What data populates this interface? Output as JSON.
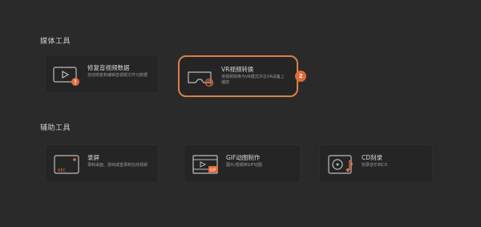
{
  "sections": {
    "media": {
      "title": "媒体工具",
      "cards": [
        {
          "name": "修复音视频数据",
          "desc": "自动修复和编辑音视频文件元数据",
          "icon": "video-repair-icon"
        },
        {
          "name": "VR视频转换",
          "desc": "将视频转换为VR模式并在VR设备上播放",
          "icon": "vr-headset-icon"
        }
      ]
    },
    "aux": {
      "title": "辅助工具",
      "cards": [
        {
          "name": "录屏",
          "desc": "录制桌面、游戏或直录制在线视频",
          "icon": "screen-record-icon"
        },
        {
          "name": "GIF动图制作",
          "desc": "图片/视频转GIF动图",
          "icon": "gif-maker-icon"
        },
        {
          "name": "CD刻录",
          "desc": "刻录音乐到CD",
          "icon": "cd-burn-icon"
        }
      ]
    }
  },
  "badge": "2",
  "colors": {
    "accent": "#d98048",
    "badge": "#e2693a",
    "background": "#2b2a2a"
  }
}
